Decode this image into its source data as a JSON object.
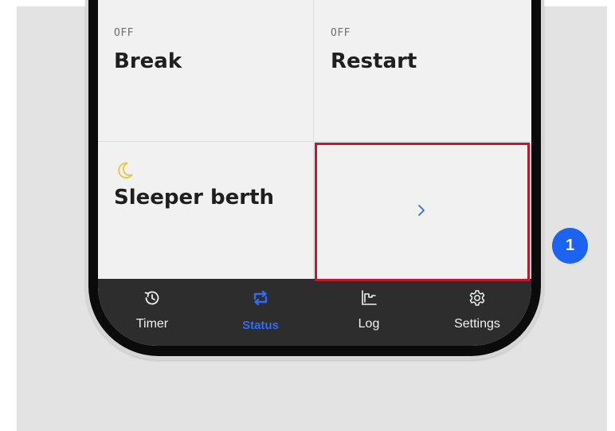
{
  "tiles": {
    "break": {
      "status": "OFF",
      "label": "Break"
    },
    "restart": {
      "status": "OFF",
      "label": "Restart"
    },
    "sleeper": {
      "icon": "moon-icon",
      "label": "Sleeper berth"
    },
    "more": {
      "icon": "chevron-right-icon"
    }
  },
  "tabbar": {
    "tabs": [
      {
        "label": "Timer",
        "icon": "history-icon",
        "active": false
      },
      {
        "label": "Status",
        "icon": "swap-arrows-icon",
        "active": true
      },
      {
        "label": "Log",
        "icon": "step-chart-icon",
        "active": false
      },
      {
        "label": "Settings",
        "icon": "gear-icon",
        "active": false
      }
    ]
  },
  "annotation": {
    "number": "1"
  },
  "colors": {
    "active_tab": "#2f6cf5",
    "highlight_border": "#c3162a",
    "badge": "#1b63f0",
    "moon_icon": "#e8c84a",
    "chevron": "#2f6cf5"
  }
}
